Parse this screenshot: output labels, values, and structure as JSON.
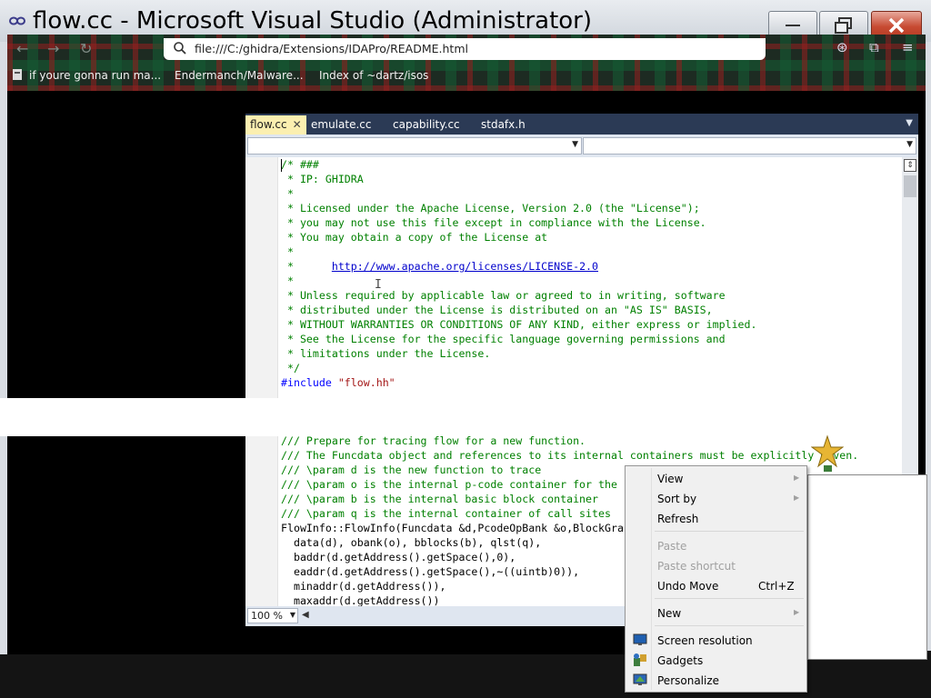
{
  "window": {
    "title": "flow.cc - Microsoft Visual Studio (Administrator)"
  },
  "browser": {
    "url": "file:///C:/ghidra/Extensions/IDAPro/README.html",
    "bookmarks": [
      "if youre gonna run ma...",
      "Endermanch/Malware...",
      "Index of ~dartz/isos"
    ]
  },
  "editor": {
    "tabs": [
      {
        "label": "flow.cc",
        "active": true
      },
      {
        "label": "emulate.cc",
        "active": false
      },
      {
        "label": "capability.cc",
        "active": false
      },
      {
        "label": "stdafx.h",
        "active": false
      }
    ],
    "zoom": "100 %",
    "code": [
      "/* ###",
      " * IP: GHIDRA",
      " *",
      " * Licensed under the Apache License, Version 2.0 (the \"License\");",
      " * you may not use this file except in compliance with the License.",
      " * You may obtain a copy of the License at",
      " *",
      " *      http://www.apache.org/licenses/LICENSE-2.0",
      " *",
      " * Unless required by applicable law or agreed to in writing, software",
      " * distributed under the License is distributed on an \"AS IS\" BASIS,",
      " * WITHOUT WARRANTIES OR CONDITIONS OF ANY KIND, either express or implied.",
      " * See the License for the specific language governing permissions and",
      " * limitations under the License.",
      " */",
      "#include \"flow.hh\"",
      "",
      "",
      "",
      "/// Prepare for tracing flow for a new function.",
      "/// The Funcdata object and references to its internal containers must be explicitly given.",
      "/// \\param d is the new function to trace",
      "/// \\param o is the internal p-code container for the",
      "/// \\param b is the internal basic block container",
      "/// \\param q is the internal container of call sites",
      "FlowInfo::FlowInfo(Funcdata &d,PcodeOpBank &o,BlockGra",
      "  data(d), obank(o), bblocks(b), qlst(q),",
      "  baddr(d.getAddress().getSpace(),0),",
      "  eaddr(d.getAddress().getSpace(),~((uintb)0)),",
      "  minaddr(d.getAddress()),",
      "  maxaddr(d.getAddress())"
    ],
    "link_text": "http://www.apache.org/licenses/LICENSE-2.0",
    "include_kw": "#include",
    "include_str": "\"flow.hh\"",
    "line_types": [
      "c",
      "c",
      "c",
      "c",
      "c",
      "c",
      "c",
      "link",
      "c",
      "c",
      "c",
      "c",
      "c",
      "c",
      "c",
      "inc",
      "p",
      "p",
      "p",
      "d",
      "d",
      "d",
      "d",
      "d",
      "d",
      "p",
      "p",
      "p",
      "p",
      "p",
      "p"
    ]
  },
  "context_menu": {
    "items": [
      {
        "label": "View",
        "submenu": true,
        "disabled": false
      },
      {
        "label": "Sort by",
        "submenu": true,
        "disabled": false
      },
      {
        "label": "Refresh",
        "submenu": false,
        "disabled": false
      },
      {
        "label": "Paste",
        "submenu": false,
        "disabled": true
      },
      {
        "label": "Paste shortcut",
        "submenu": false,
        "disabled": true
      },
      {
        "label": "Undo Move",
        "shortcut": "Ctrl+Z",
        "submenu": false,
        "disabled": false
      },
      {
        "label": "New",
        "submenu": true,
        "disabled": false
      },
      {
        "label": "Screen resolution",
        "submenu": false,
        "disabled": false,
        "icon": "monitor-icon"
      },
      {
        "label": "Gadgets",
        "submenu": false,
        "disabled": false,
        "icon": "gadgets-icon"
      },
      {
        "label": "Personalize",
        "submenu": false,
        "disabled": false,
        "icon": "personalize-icon"
      }
    ]
  },
  "colors": {
    "comment": "#008000",
    "keyword": "#0000ff",
    "string": "#a31515",
    "link": "#0000cc",
    "tab_strip": "#2b3a55",
    "active_tab": "#fbefb0",
    "close_button": "#c74a32"
  }
}
